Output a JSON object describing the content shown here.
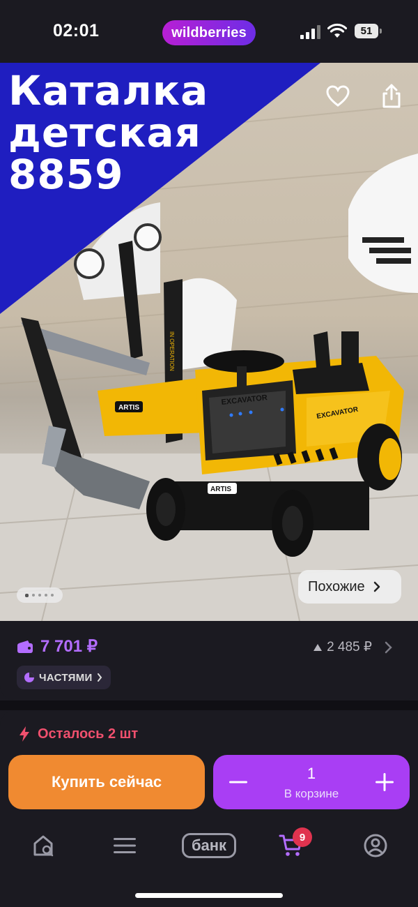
{
  "status_bar": {
    "time": "02:01",
    "brand": "wildberries",
    "battery": "51"
  },
  "product_image": {
    "banner_lines": [
      "Каталка",
      "детская",
      "8859"
    ],
    "similar_label": "Похожие",
    "page_count": 5,
    "current_page": 1,
    "toy_labels": {
      "bucket_brand": "ARTIS",
      "cab_label": "EXCAVATOR",
      "arm_text": "IN OPERATION"
    }
  },
  "price_panel": {
    "price": "7 701 ₽",
    "old_price": "2 485 ₽",
    "parts_label": "ЧАСТЯМИ"
  },
  "buy_panel": {
    "stock_text": "Осталось 2 шт",
    "buy_now_label": "Купить сейчас",
    "quantity": "1",
    "in_cart_label": "В корзине"
  },
  "tab_bar": {
    "bank_label": "банк",
    "cart_count": "9"
  },
  "colors": {
    "background": "#1b1a21",
    "accent_purple": "#a93ef4",
    "price_purple": "#b36dff",
    "buy_orange": "#f08a31",
    "stock_red": "#f0506e",
    "banner_blue": "#1f1ec0",
    "toy_yellow": "#f2b705"
  }
}
